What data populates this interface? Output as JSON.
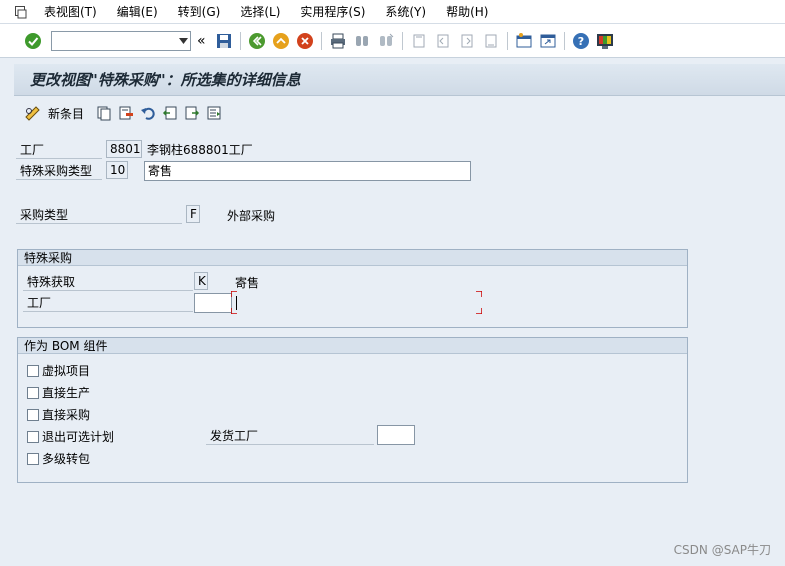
{
  "menubar": {
    "items": [
      {
        "label": "表视图(T)"
      },
      {
        "label": "编辑(E)"
      },
      {
        "label": "转到(G)"
      },
      {
        "label": "选择(L)"
      },
      {
        "label": "实用程序(S)"
      },
      {
        "label": "系统(Y)"
      },
      {
        "label": "帮助(H)"
      }
    ]
  },
  "toolbar": {
    "command_field_value": "",
    "back_chevron": "«"
  },
  "title": "更改视图\"特殊采购\"：所选集的详细信息",
  "app_toolbar": {
    "new_entries_label": "新条目"
  },
  "fields": {
    "plant_label": "工厂",
    "plant_value": "8801",
    "plant_desc": "李钢柱688801工厂",
    "sp_type_label": "特殊采购类型",
    "sp_type_value": "10",
    "sp_type_desc": "寄售",
    "proc_type_label": "采购类型",
    "proc_type_value": "F",
    "proc_type_desc": "外部采购"
  },
  "special_procurement": {
    "title": "特殊采购",
    "sp_label": "特殊获取",
    "sp_value": "K",
    "sp_desc": "寄售",
    "plant_label": "工厂",
    "plant_value": ""
  },
  "bom": {
    "title": "作为 BOM 组件",
    "checkboxes": [
      {
        "label": "虚拟项目"
      },
      {
        "label": "直接生产"
      },
      {
        "label": "直接采购"
      },
      {
        "label": "退出可选计划"
      },
      {
        "label": "多级转包"
      }
    ],
    "issue_plant_label": "发货工厂",
    "issue_plant_value": ""
  },
  "watermark": "CSDN @SAP牛刀",
  "colors": {
    "background": "#e8eef5",
    "title_bar": "#d3dee9",
    "focus_corner": "#cc0000"
  }
}
